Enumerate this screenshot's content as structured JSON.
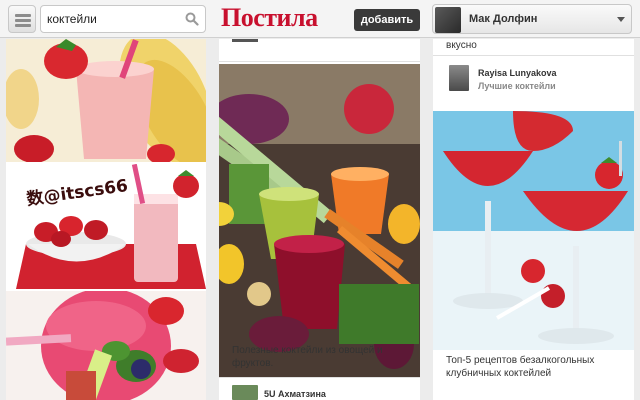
{
  "header": {
    "search_value": "коктейли",
    "logo_text": "Постила",
    "add_button": "добавить",
    "user_name": "Мак Долфин"
  },
  "col1": {
    "watermark": "数@itscs66"
  },
  "col2": {
    "caption": "Полезные коктейли из овощей и фруктов.",
    "pinner": "5U Ахматзина"
  },
  "col3": {
    "top_text": "вкусно",
    "pinner": "Rayisa Lunyakova",
    "board": "Лучшие коктейли",
    "caption": "Топ-5 рецептов безалкогольных клубничных коктейлей"
  },
  "colors": {
    "logo": "#c8102e",
    "add_button_bg": "#3a3a3a"
  }
}
